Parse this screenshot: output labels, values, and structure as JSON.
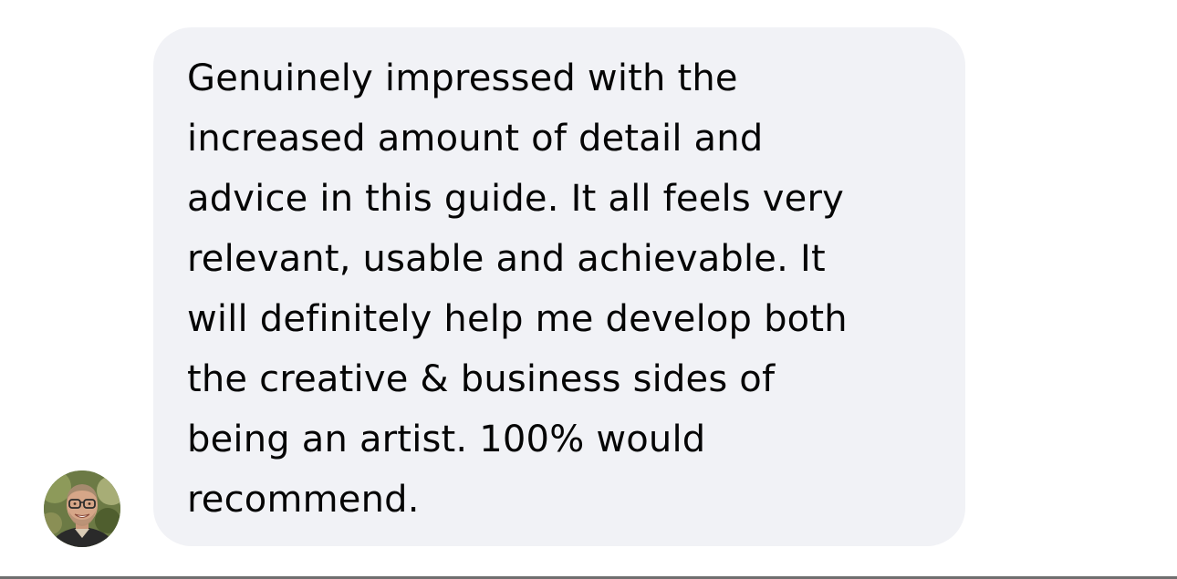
{
  "message": {
    "text": "Genuinely impressed with the\nincreased amount of detail and\nadvice in this guide. It all feels very\nrelevant, usable and achievable. It\nwill definitely help me develop both\nthe creative & business sides of\nbeing an artist. 100% would\nrecommend.",
    "bubble_color": "#f1f2f6",
    "text_color": "#050505"
  },
  "sender": {
    "avatar_icon": "profile-photo"
  }
}
